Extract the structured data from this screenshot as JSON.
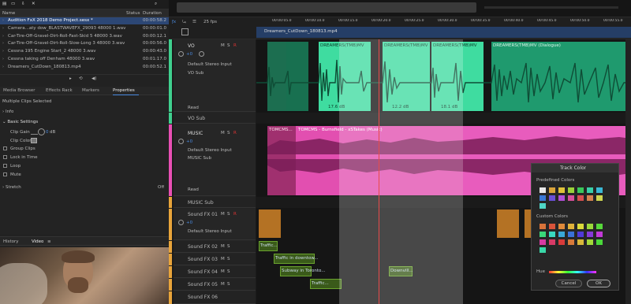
{
  "files": {
    "headers": {
      "name": "Name",
      "status": "Status",
      "duration": "Duration"
    },
    "rows": [
      {
        "name": "Audition FxX 2018 Demo Project.sesx *",
        "duration": "00:00:58.2",
        "selected": true
      },
      {
        "name": "Camera...aty dow_BLASTWAVEFX_29093 48000 1.wav",
        "duration": "00:00:01.0"
      },
      {
        "name": "Car-Tire-Off-Gravel-Dirt-Roll-Fast-Skid 5 48000 3.wav",
        "duration": "00:00:12.1"
      },
      {
        "name": "Car-Tire-Off-Gravel-Dirt-Roll-Slow-Long 3 48000 3.wav",
        "duration": "00:00:56.0"
      },
      {
        "name": "Cessna 195 Engine Start_2 48000 3.wav",
        "duration": "00:00:43.0"
      },
      {
        "name": "Cessna taking off Denham 48000 3.wav",
        "duration": "00:01:17.0"
      },
      {
        "name": "Dreamers_CutDown_180813.mp4",
        "duration": "00:00:52.1"
      }
    ]
  },
  "panels": {
    "tabs": [
      "Media Browser",
      "Effects Rack",
      "Markers",
      "Properties"
    ],
    "active": "Properties"
  },
  "properties": {
    "heading": "Multiple Clips Selected",
    "info": "Info",
    "basic": "Basic Settings",
    "clip_gain_label": "Clip Gain",
    "clip_gain_value": "0",
    "clip_gain_unit": "dB",
    "clip_color_label": "Clip Color",
    "checks": [
      "Group Clips",
      "Lock in Time",
      "Loop",
      "Mute"
    ],
    "stretch": "Stretch",
    "stretch_value": "Off"
  },
  "bottom_tabs": [
    "History",
    "Video"
  ],
  "timeline": {
    "fps": "25 fps",
    "ruler": [
      "00:00:05.0",
      "00:00:10.0",
      "00:00:15.0",
      "00:00:20.0",
      "00:00:25.0",
      "00:00:30.0",
      "00:00:35.0",
      "00:00:40.0",
      "00:00:45.0",
      "00:00:50.0",
      "00:00:55.0"
    ],
    "video_clip": "Dreamers_CutDown_180813.mp4"
  },
  "tracks": {
    "vo": {
      "name": "VO",
      "volume": "+0",
      "input": "Default Stereo Input",
      "output": "VO Sub",
      "mode": "Read"
    },
    "vo_sub": {
      "name": "VO Sub"
    },
    "music": {
      "name": "MUSIC",
      "volume": "+0",
      "input": "Default Stereo Input",
      "output": "MUSIC Sub",
      "mode": "Read"
    },
    "music_sub": {
      "name": "MUSIC Sub"
    },
    "sfx": [
      {
        "name": "Sound FX 01",
        "volume": "+0",
        "input": "Default Stereo Input"
      },
      {
        "name": "Sound FX 02"
      },
      {
        "name": "Sound FX 03"
      },
      {
        "name": "Sound FX 04"
      },
      {
        "name": "Sound FX 05"
      },
      {
        "name": "Sound FX 06"
      }
    ],
    "buttons": {
      "m": "M",
      "s": "S",
      "r": "R",
      "i": "I"
    }
  },
  "clips": {
    "vo": [
      "DREAMERS(TMB)MV",
      "DREAMERS(TMB)MV",
      "DREAMERS(TMB)MV",
      "DREAMERS(TMB)MV (Dialogue)"
    ],
    "vo_gain": [
      "17.6 dB",
      "12.2 dB",
      "18.1 dB"
    ],
    "music": [
      "TOMCMS...",
      "TOMCMS - Burnsfield - xSTakes (Music)"
    ],
    "sfx": [
      "Traffic...",
      "Traffic in downtow...",
      "Subway in Toronto...",
      "Downvill...",
      "Traffic..."
    ]
  },
  "track_color": {
    "title": "Track Color",
    "predefined_label": "Predefined Colors",
    "custom_label": "Custom Colors",
    "hue_label": "Hue",
    "cancel": "Cancel",
    "ok": "OK",
    "predefined": [
      "#e8e8e8",
      "#d9a33a",
      "#e0c23a",
      "#9bd23a",
      "#3ac75a",
      "#3ad0a8",
      "#3ab8d6",
      "#3a78d6",
      "#6a4fd6",
      "#b04fd6",
      "#d64f9a",
      "#d64f4f",
      "#d6834f",
      "#cfd64f",
      "#4fd6c7"
    ],
    "custom": [
      "#d9733a",
      "#d9543a",
      "#e08a3a",
      "#e0b23a",
      "#dada3a",
      "#9ad83a",
      "#56d83a",
      "#3ad87a",
      "#3ad8c0",
      "#3aa8d8",
      "#3a72d8",
      "#503ad8",
      "#863ad8",
      "#c23ad8",
      "#d83aa2",
      "#d83a66",
      "#d83a3a",
      "#d87a3a",
      "#d8b83a",
      "#a2d83a",
      "#4ad83a",
      "#3ad8a8"
    ]
  }
}
